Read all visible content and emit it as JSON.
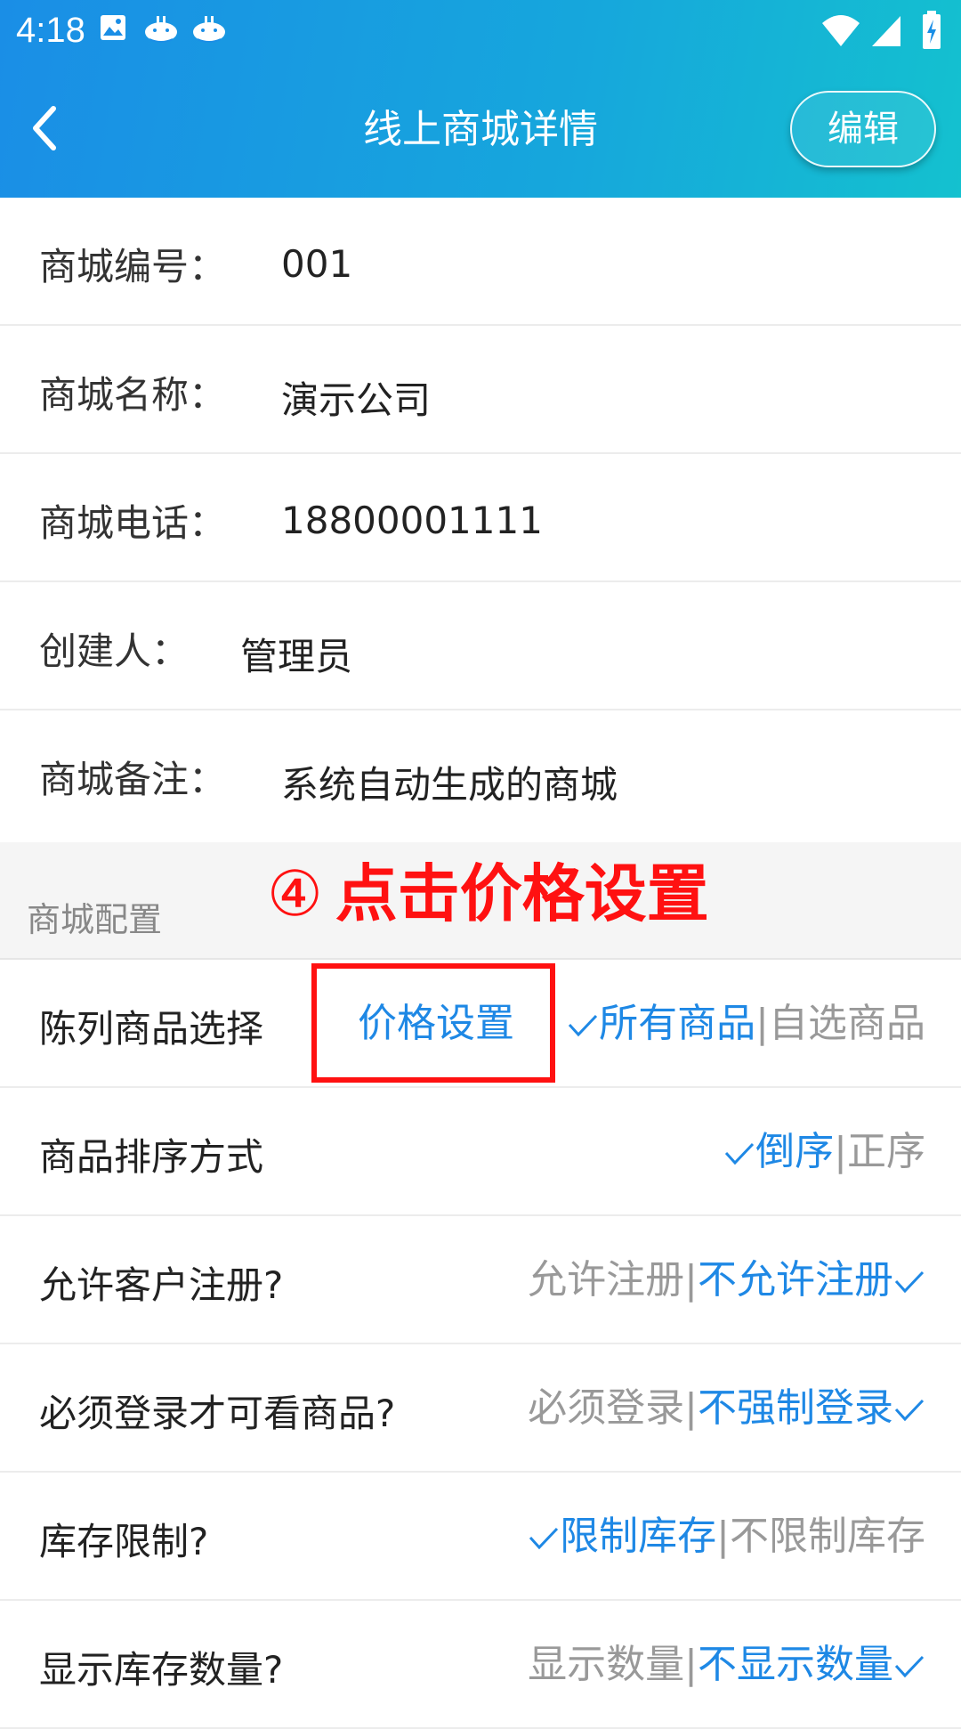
{
  "status_bar": {
    "time": "4:18",
    "left_icons": [
      "image-icon",
      "whale-icon",
      "whale-icon"
    ],
    "right_icons": [
      "wifi-icon",
      "signal-icon",
      "battery-charging-icon"
    ]
  },
  "header": {
    "back_icon": "chevron-left-icon",
    "title": "线上商城详情",
    "edit_label": "编辑",
    "gradient_colors": [
      "#1a8ee6",
      "#14c1cf"
    ]
  },
  "info": [
    {
      "label": "商城编号：",
      "value": "001"
    },
    {
      "label": "商城名称：",
      "value": "演示公司"
    },
    {
      "label": "商城电话：",
      "value": "18800001111"
    },
    {
      "label": "创建人：",
      "value": "管理员"
    },
    {
      "label": "商城备注：",
      "value": "系统自动生成的商城"
    }
  ],
  "section": {
    "title": "商城配置",
    "annotation_number": "④",
    "annotation_text": "点击价格设置"
  },
  "config": [
    {
      "label": "陈列商品选择",
      "extra_link": "价格设置",
      "options": [
        {
          "label": "所有商品",
          "active": true
        },
        {
          "label": "自选商品",
          "active": false
        }
      ]
    },
    {
      "label": "商品排序方式",
      "options": [
        {
          "label": "倒序",
          "active": true
        },
        {
          "label": "正序",
          "active": false
        }
      ]
    },
    {
      "label": "允许客户注册?",
      "options": [
        {
          "label": "允许注册",
          "active": false
        },
        {
          "label": "不允许注册",
          "active": true
        }
      ]
    },
    {
      "label": "必须登录才可看商品?",
      "options": [
        {
          "label": "必须登录",
          "active": false
        },
        {
          "label": "不强制登录",
          "active": true
        }
      ]
    },
    {
      "label": "库存限制?",
      "options": [
        {
          "label": "限制库存",
          "active": true
        },
        {
          "label": "不限制库存",
          "active": false
        }
      ]
    },
    {
      "label": "显示库存数量?",
      "options": [
        {
          "label": "显示数量",
          "active": false
        },
        {
          "label": "不显示数量",
          "active": true
        }
      ]
    }
  ],
  "colors": {
    "accent": "#1e88e5",
    "inactive": "#999999",
    "annotation": "#ff1111"
  }
}
